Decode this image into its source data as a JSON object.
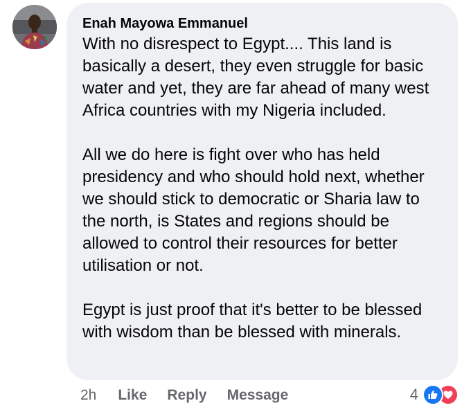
{
  "comment": {
    "author": "Enah Mayowa Emmanuel",
    "paragraphs": [
      "With no disrespect to Egypt.... This land is basically a desert, they even struggle for basic water and yet, they are far ahead of many west Africa countries with my Nigeria included.",
      "All we do here is fight over who has held presidency and who should hold next, whether we should stick to democratic or Sharia law to the north, is States and regions should be allowed to control their resources for better utilisation or not.",
      "Egypt is just proof that it's better to be blessed with wisdom than be blessed with minerals."
    ],
    "timestamp": "2h",
    "like_label": "Like",
    "reply_label": "Reply",
    "message_label": "Message",
    "reaction_count": "4",
    "reactions": [
      "like-icon",
      "love-icon"
    ]
  },
  "colors": {
    "bubble_background": "#eef0f4",
    "text": "#050505",
    "secondary_text": "#65676b",
    "like_blue": "#1877f2",
    "love_red": "#f33e58"
  }
}
